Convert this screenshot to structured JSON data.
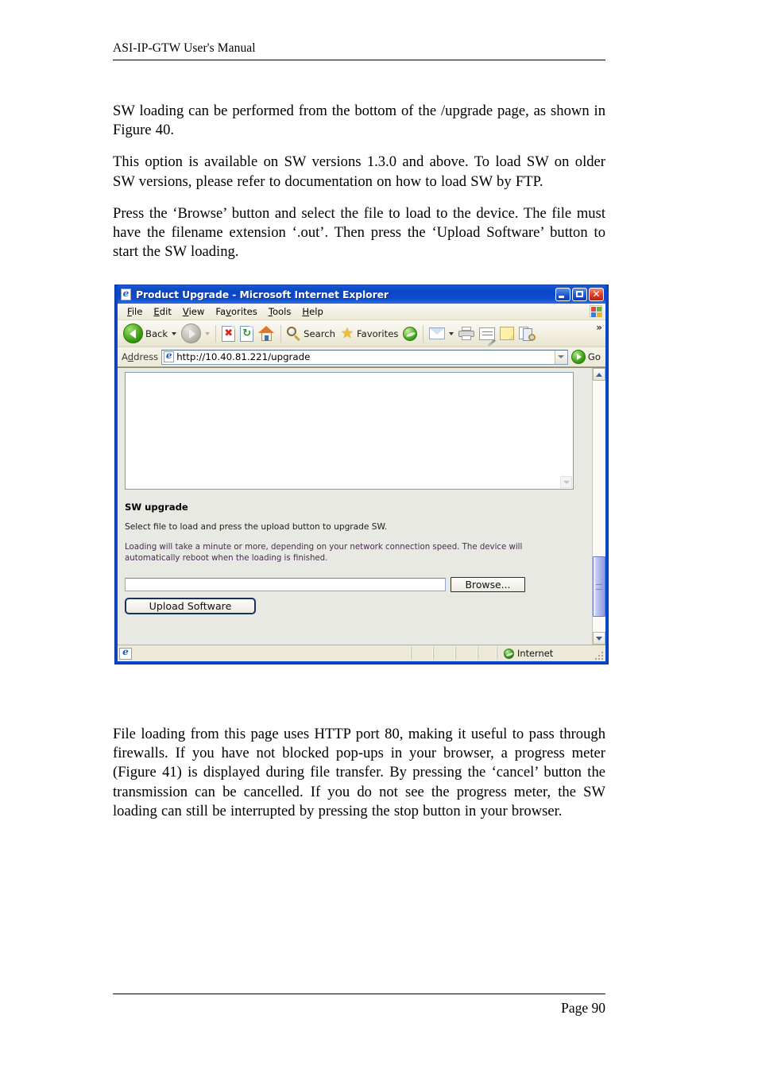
{
  "document": {
    "header_title": "ASI-IP-GTW User's Manual",
    "paragraphs": [
      "SW loading can be performed from the bottom of the /upgrade page, as shown in Figure 40.",
      "This option is available on SW versions 1.3.0 and above. To load SW on older SW versions, please refer to documentation on how to load SW by FTP.",
      "Press the ‘Browse’ button and select the file to load to the device. The file must have the filename extension ‘.out’. Then press the ‘Upload Software’ button to start the SW loading."
    ],
    "trailing_paragraph": "File loading from this page uses HTTP port 80, making it useful to pass through firewalls. If you have not blocked pop-ups in your browser, a progress meter (Figure 41) is displayed during file transfer. By pressing the ‘cancel’ button the transmission can be cancelled. If you do not see the progress meter, the SW loading can still be interrupted by pressing the stop button in your browser.",
    "page_number": "Page 90"
  },
  "browser": {
    "title": "Product Upgrade - Microsoft Internet Explorer",
    "window_buttons": {
      "minimize": "Minimize",
      "maximize": "Maximize",
      "close": "Close"
    },
    "menu": [
      {
        "label": "File",
        "accel": "F",
        "rest": "ile"
      },
      {
        "label": "Edit",
        "accel": "E",
        "rest": "dit"
      },
      {
        "label": "View",
        "accel": "V",
        "rest": "iew"
      },
      {
        "label": "Favorites",
        "pre": "Fa",
        "accel": "v",
        "rest": "orites"
      },
      {
        "label": "Tools",
        "accel": "T",
        "rest": "ools"
      },
      {
        "label": "Help",
        "accel": "H",
        "rest": "elp"
      }
    ],
    "toolbar": {
      "back_label": "Back",
      "forward_label": "Forward",
      "stop_label": "Stop",
      "refresh_label": "Refresh",
      "home_label": "Home",
      "search_label": "Search",
      "favorites_label": "Favorites",
      "media_label": "Media",
      "mail_label": "Mail",
      "print_label": "Print",
      "edit_label": "Edit",
      "notes_label": "Notes",
      "discuss_label": "Discuss",
      "overflow_label": "»"
    },
    "address": {
      "label": "Address",
      "pre": "A",
      "accel": "d",
      "rest": "dress",
      "url": "http://10.40.81.221/upgrade",
      "go_label": "Go"
    },
    "content": {
      "heading": "SW upgrade",
      "instruction": "Select file to load and press the upload button to upgrade SW.",
      "warning": "Loading will take a minute or more, depending on your network connection speed. The device will automatically reboot when the loading is finished.",
      "file_value": "",
      "file_placeholder": "",
      "browse_label": "Browse...",
      "upload_label": "Upload Software"
    },
    "statusbar": {
      "message": "",
      "zone_label": "Internet"
    }
  },
  "colors": {
    "title_bar": "#0a46c8",
    "toolbar_bg": "#ece9d8",
    "warning_text": "#4a2a52",
    "go_green": "#3da316",
    "close_red": "#e04a32"
  }
}
